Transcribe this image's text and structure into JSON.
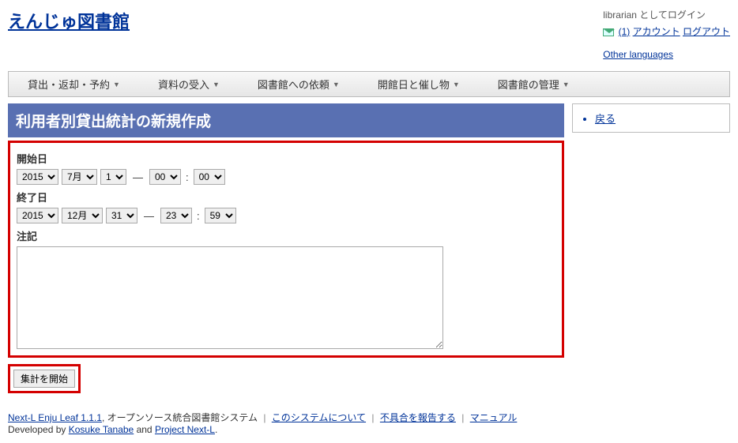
{
  "header": {
    "site_title": "えんじゅ図書館",
    "login_status": "librarian としてログイン",
    "unread": "(1)",
    "account": "アカウント",
    "logout": "ログアウト",
    "other_lang": "Other languages"
  },
  "nav": [
    "貸出・返却・予約",
    "資料の受入",
    "図書館への依頼",
    "開館日と催し物",
    "図書館の管理"
  ],
  "page_title": "利用者別貸出統計の新規作成",
  "form": {
    "start_label": "開始日",
    "end_label": "終了日",
    "note_label": "注記",
    "start": {
      "year": "2015",
      "month": "7月",
      "day": "1",
      "hour": "00",
      "min": "00"
    },
    "end": {
      "year": "2015",
      "month": "12月",
      "day": "31",
      "hour": "23",
      "min": "59"
    },
    "note_value": "",
    "dash": "—",
    "colon": ":",
    "submit": "集計を開始"
  },
  "side": {
    "back": "戻る"
  },
  "footer": {
    "product": "Next-L Enju Leaf 1.1.1",
    "desc": ", オープンソース統合図書館システム",
    "about": "このシステムについて",
    "report": "不具合を報告する",
    "manual": "マニュアル",
    "dev_by": "Developed by ",
    "author": "Kosuke Tanabe",
    "and": " and ",
    "project": "Project Next-L",
    "period": "."
  }
}
